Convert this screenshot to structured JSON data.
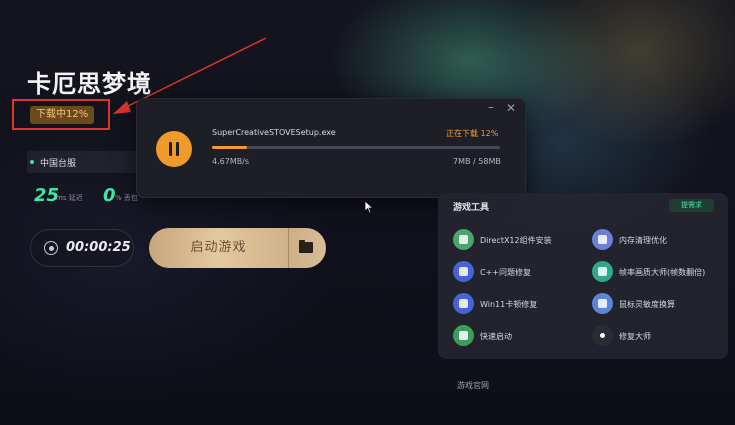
{
  "game": {
    "title": "卡厄思梦境",
    "download_badge": "下载中12%"
  },
  "server": {
    "name": "中国台服",
    "latency_value": "25",
    "latency_unit": "ms 延迟",
    "loss_value": "0",
    "loss_unit": "% 丢包"
  },
  "timer": {
    "elapsed": "00:00:25"
  },
  "launch": {
    "label": "启动游戏"
  },
  "download": {
    "file_name": "SuperCreativeSTOVESetup.exe",
    "status": "正在下载 12%",
    "progress_percent": 12,
    "speed": "4.67MB/s",
    "size": "7MB / 58MB",
    "minimize": "–",
    "close": "✕"
  },
  "tools": {
    "title": "游戏工具",
    "request_label": "提需求",
    "items": [
      {
        "label": "DirectX12组件安装",
        "icon": "directx-icon",
        "color": "#4ea36e"
      },
      {
        "label": "内存清理优化",
        "icon": "memory-icon",
        "color": "#6b7fd6"
      },
      {
        "label": "C++问题修复",
        "icon": "wrench-icon",
        "color": "#4a63d4"
      },
      {
        "label": "帧率画质大师(帧数翻倍)",
        "icon": "fps-icon",
        "color": "#2fa88a"
      },
      {
        "label": "Win11卡顿修复",
        "icon": "wrench-icon",
        "color": "#4a63d4"
      },
      {
        "label": "鼠标灵敏度换算",
        "icon": "mouse-icon",
        "color": "#5b86d8"
      },
      {
        "label": "快速启动",
        "icon": "rocket-icon",
        "color": "#3f9a5c"
      },
      {
        "label": "修复大师",
        "icon": "repair-icon",
        "color": "#2a2b33"
      }
    ]
  },
  "footer": {
    "site_link": "游戏官网"
  },
  "colors": {
    "accent_orange": "#f09a2c",
    "accent_green": "#41e6a6",
    "annotation_red": "#e0352b"
  }
}
